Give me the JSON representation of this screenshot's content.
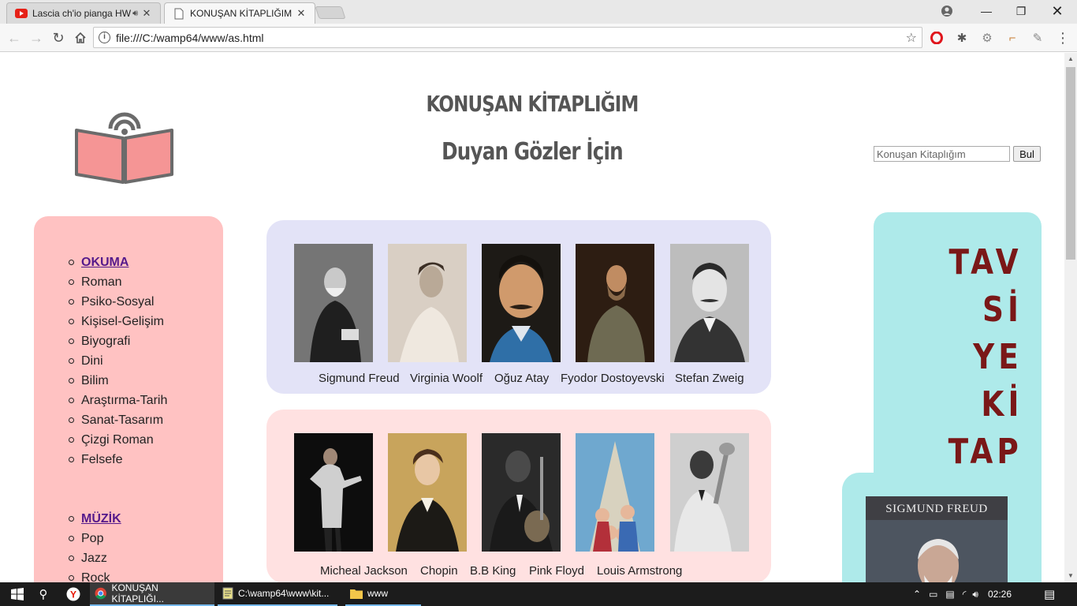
{
  "browser": {
    "tabs": [
      {
        "title": "Lascia ch'io pianga HWV",
        "favicon": "youtube-icon",
        "audio": true
      },
      {
        "title": "KONUŞAN KİTAPLIĞIM",
        "favicon": "page-icon",
        "audio": false
      }
    ],
    "url": "file:///C:/wamp64/www/as.html"
  },
  "page": {
    "title": "KONUŞAN KİTAPLIĞIM",
    "subtitle": "Duyan Gözler İçin",
    "search": {
      "placeholder": "Konuşan Kitaplığım",
      "button": "Bul"
    },
    "sidebar": {
      "reading": {
        "heading": "OKUMA",
        "items": [
          "Roman",
          "Psiko-Sosyal",
          "Kişisel-Gelişim",
          "Biyografi",
          "Dini",
          "Bilim",
          "Araştırma-Tarih",
          "Sanat-Tasarım",
          "Çizgi Roman",
          "Felsefe"
        ]
      },
      "music": {
        "heading": "MÜZİK",
        "items": [
          "Pop",
          "Jazz",
          "Rock"
        ]
      }
    },
    "authors": [
      "Sigmund  Freud",
      "Virginia  Woolf",
      "Oğuz  Atay",
      "Fyodor  Dostoyevski",
      "Stefan  Zweig"
    ],
    "musicians": [
      "Micheal Jackson",
      "Chopin",
      "B.B King",
      "Pink Floyd",
      "Louis Armstrong"
    ],
    "recommend": {
      "lines": [
        "TAV",
        "Sİ",
        "YE",
        "Kİ",
        "TAP"
      ],
      "book_title": "SIGMUND FREUD"
    }
  },
  "taskbar": {
    "items": [
      "KONUŞAN KİTAPLIĞI...",
      "C:\\wamp64\\www\\kit...",
      "www"
    ],
    "time": "02:26"
  },
  "colors": {
    "sidebar_bg": "#ffc2c2",
    "authors_row_bg": "#e3e3f7",
    "music_row_bg": "#ffe1e1",
    "recommend_bg": "#aeeaea",
    "recommend_text": "#7a1818",
    "link": "#551a8b"
  }
}
